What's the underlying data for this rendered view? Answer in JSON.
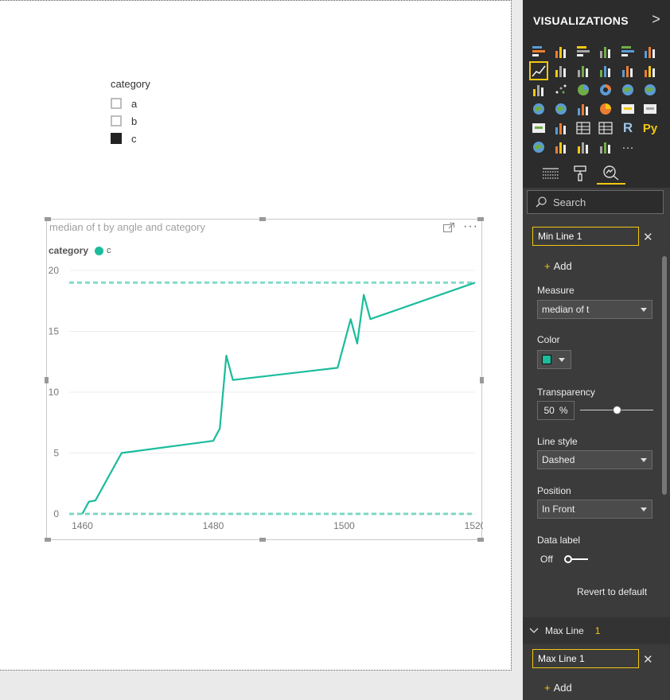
{
  "slicer": {
    "title": "category",
    "items": [
      {
        "label": "a",
        "checked": false
      },
      {
        "label": "b",
        "checked": false
      },
      {
        "label": "c",
        "checked": true
      }
    ]
  },
  "visual": {
    "title": "median of t by angle and category",
    "legend_title": "category",
    "legend_item": "c",
    "series_color": "#1abc9c",
    "more_label": "···"
  },
  "chart_data": {
    "type": "line",
    "series": [
      {
        "name": "c",
        "x": [
          1460,
          1461,
          1462,
          1466,
          1480,
          1481,
          1482,
          1483,
          1499,
          1501,
          1502,
          1503,
          1504,
          1520
        ],
        "y": [
          0,
          1,
          1.1,
          5,
          6,
          7,
          13,
          11,
          12,
          16,
          14,
          18,
          16,
          19
        ]
      }
    ],
    "reference_lines": [
      {
        "kind": "min",
        "value": 0,
        "style": "dashed"
      },
      {
        "kind": "max",
        "value": 19,
        "style": "dashed"
      }
    ],
    "xlim": [
      1458,
      1520
    ],
    "ylim": [
      0,
      20
    ],
    "xticks": [
      "1460",
      "1480",
      "1500",
      "1520"
    ],
    "yticks": [
      "0",
      "5",
      "10",
      "15",
      "20"
    ],
    "grid": true
  },
  "pane": {
    "header_title": "VISUALIZATIONS",
    "chevron": ">",
    "search_placeholder": "Search",
    "min_line_name": "Min Line 1",
    "add_label": "Add",
    "add_plus": "+",
    "measure_label": "Measure",
    "measure_value": "median of t",
    "color_label": "Color",
    "swatch_color": "#1abc9c",
    "transparency_label": "Transparency",
    "transparency_value": "50",
    "transparency_unit": "%",
    "transparency_level": 0.5,
    "line_style_label": "Line style",
    "line_style_value": "Dashed",
    "position_label": "Position",
    "position_value": "In Front",
    "data_label_label": "Data label",
    "data_label_state": "Off",
    "revert_label": "Revert to default",
    "max_line_section": "Max Line",
    "max_line_count": "1",
    "max_line_name": "Max Line 1",
    "close_glyph": "✕",
    "viz_icons": [
      "stacked-bar-icon",
      "stacked-column-icon",
      "clustered-bar-icon",
      "clustered-column-icon",
      "100-stacked-bar-icon",
      "100-stacked-column-icon",
      "line-chart-icon",
      "area-chart-icon",
      "stacked-area-icon",
      "line-clustered-column-icon",
      "line-stacked-column-icon",
      "ribbon-chart-icon",
      "waterfall-icon",
      "scatter-icon",
      "pie-icon",
      "donut-icon",
      "treemap-icon",
      "map-icon",
      "filled-map-icon",
      "shape-map-icon",
      "funnel-icon",
      "gauge-icon",
      "card-icon",
      "multirow-card-icon",
      "kpi-icon",
      "slicer-icon",
      "table-icon",
      "matrix-icon",
      "r-visual-icon",
      "python-visual-icon",
      "arcgis-icon",
      "key-influencers-icon",
      "decomposition-tree-icon",
      "custom-line-icon",
      "more-visuals-icon"
    ],
    "r_label": "R",
    "py_label": "Py",
    "more_visuals_label": "···",
    "accent_color": "#f2c811"
  }
}
